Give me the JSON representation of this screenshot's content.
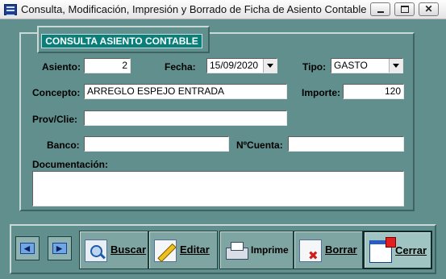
{
  "window": {
    "title": "Consulta, Modificación, Impresión y Borrado de Ficha de Asiento Contable",
    "controls": {
      "minimize_icon": "minimize-icon",
      "maximize_icon": "maximize-icon",
      "close_glyph": "✕"
    }
  },
  "header": {
    "badge": "CONSULTA ASIENTO CONTABLE"
  },
  "form": {
    "asiento": {
      "label": "Asiento:",
      "value": "2"
    },
    "fecha": {
      "label": "Fecha:",
      "value": "15/09/2020"
    },
    "tipo": {
      "label": "Tipo:",
      "value": "GASTO"
    },
    "concepto": {
      "label": "Concepto:",
      "value": "ARREGLO ESPEJO ENTRADA"
    },
    "importe": {
      "label": "Importe:",
      "value": "120"
    },
    "prov_clie": {
      "label": "Prov/Clie:",
      "value": ""
    },
    "banco": {
      "label": "Banco:",
      "value": ""
    },
    "ncuenta": {
      "label": "NºCuenta:",
      "value": ""
    },
    "documentacion": {
      "label": "Documentación:",
      "value": ""
    }
  },
  "toolbar": {
    "prev_icon": "arrow-left-icon",
    "next_icon": "arrow-right-icon",
    "prev_glyph": "◀",
    "next_glyph": "▶",
    "buscar": "Buscar",
    "editar": "Editar",
    "imprime": "Imprime",
    "borrar": "Borrar",
    "cerrar": "Cerrar"
  },
  "colors": {
    "background": "#618f8d",
    "header_badge": "#0a7f7a",
    "button_face": "#7fa5a3"
  }
}
